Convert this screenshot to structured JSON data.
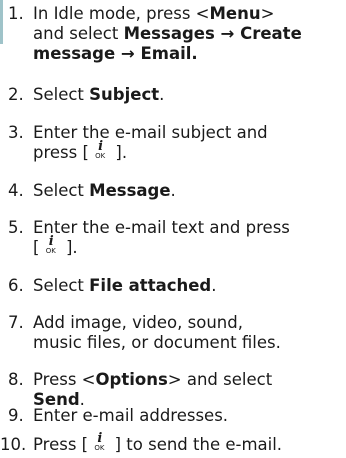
{
  "steps": [
    {
      "num": "1.",
      "lines": [
        [
          "In Idle mode, press <",
          "Menu",
          ">"
        ],
        [
          "and select ",
          "Messages",
          " → ",
          "Create"
        ],
        [
          "message",
          " → ",
          "Email",
          "."
        ]
      ]
    },
    {
      "num": "2.",
      "line": [
        "Select ",
        "Subject",
        "."
      ]
    },
    {
      "num": "3.",
      "lines": [
        [
          "Enter the e-mail subject and"
        ],
        [
          "press [",
          "",
          "]."
        ]
      ]
    },
    {
      "num": "4.",
      "line": [
        "Select ",
        "Message",
        "."
      ]
    },
    {
      "num": "5.",
      "lines": [
        [
          "Enter the e-mail text and press"
        ],
        [
          "[",
          "",
          "]."
        ]
      ]
    },
    {
      "num": "6.",
      "line": [
        "Select ",
        "File attached",
        "."
      ]
    },
    {
      "num": "7.",
      "lines": [
        [
          "Add image, video, sound,"
        ],
        [
          "music files, or document files."
        ]
      ]
    },
    {
      "num": "8.",
      "lines": [
        [
          "Press <",
          "Options",
          "> and select"
        ],
        [
          "Send",
          "."
        ]
      ]
    },
    {
      "num": "9.",
      "line": [
        "Enter e-mail addresses."
      ]
    },
    {
      "num": "10.",
      "line": [
        "Press [",
        "",
        "] to send the e-mail."
      ]
    }
  ],
  "icon": {
    "glyph": "i",
    "label": "OK"
  }
}
